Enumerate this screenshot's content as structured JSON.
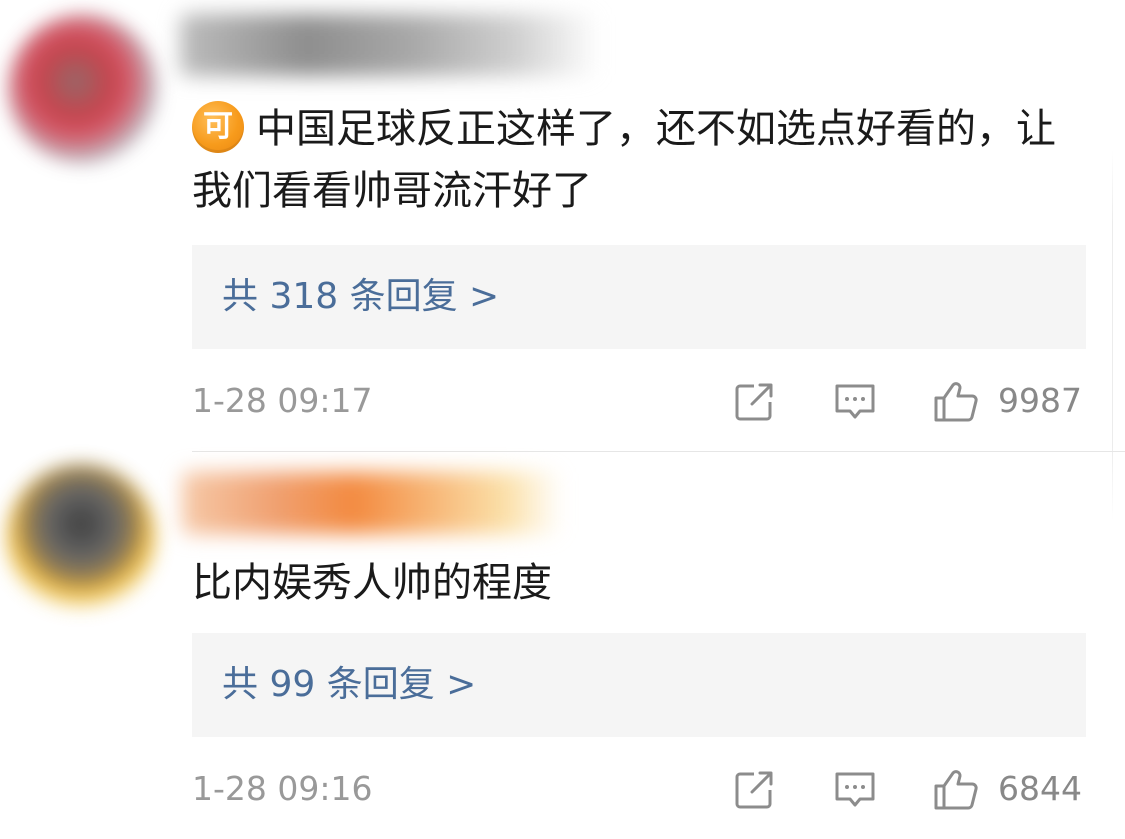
{
  "comments": [
    {
      "badge": "可",
      "text": "中国足球反正这样了，还不如选点好看的，让我们看看帅哥流汗好了",
      "replies_label": "共 318 条回复 >",
      "time": "1-28 09:17",
      "likes": "9987"
    },
    {
      "text": "比内娱秀人帅的程度",
      "replies_label": "共 99 条回复 >",
      "time": "1-28 09:16",
      "likes": "6844"
    }
  ],
  "colors": {
    "reply_link": "#4a6d99",
    "meta_text": "#999999",
    "badge": "#f79b1c",
    "reply_bg": "#f5f5f5"
  },
  "icons": [
    "share-icon",
    "comment-icon",
    "like-icon"
  ]
}
